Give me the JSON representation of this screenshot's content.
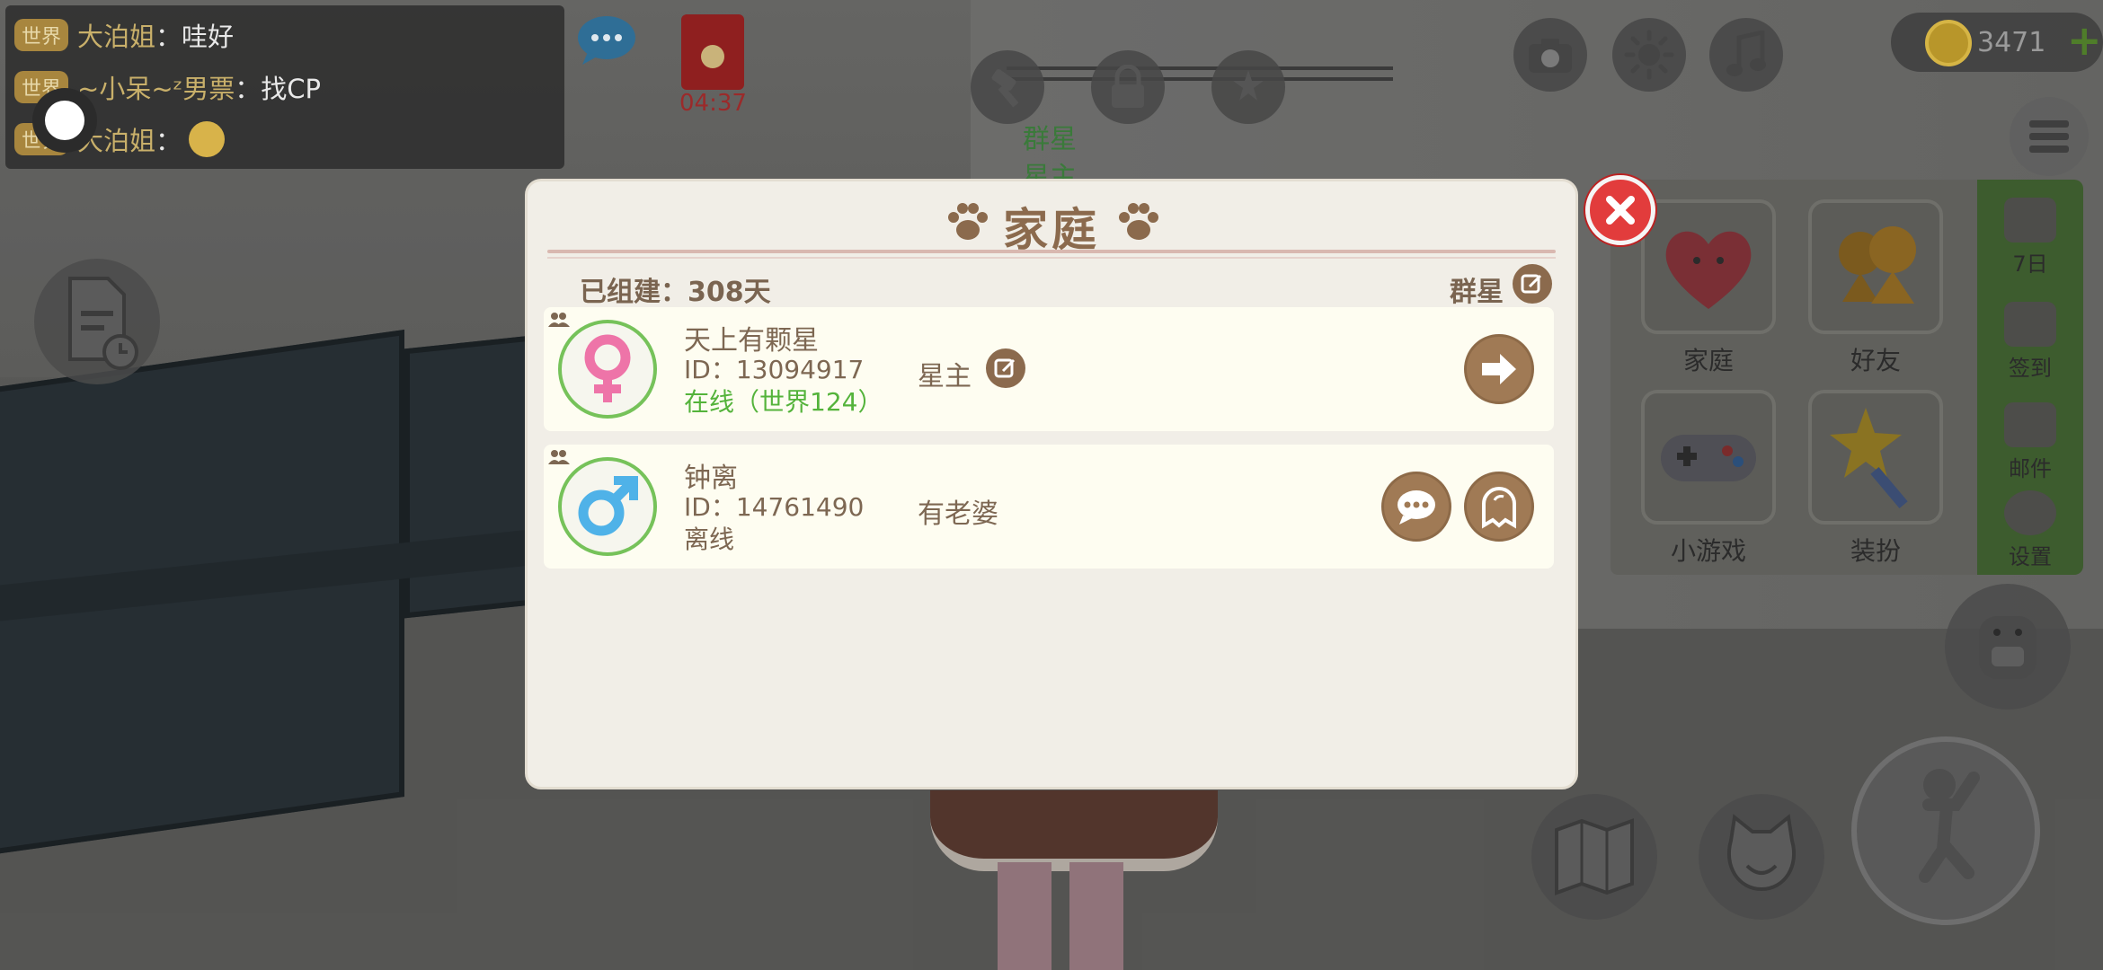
{
  "chat": {
    "lines": [
      {
        "tag": "世界",
        "name": "大泊姐",
        "sep": "：",
        "text": "哇好"
      },
      {
        "tag": "世界",
        "name": "~小呆~ᶻ男票",
        "sep": "：",
        "text": "找CP"
      },
      {
        "tag": "世界",
        "name": "大泊姐",
        "sep": "：",
        "text": ""
      }
    ]
  },
  "red_packet": {
    "timer": "04:37"
  },
  "coins": {
    "amount": "3471"
  },
  "background_labels": {
    "label1": "群星",
    "label2": "星主"
  },
  "menu": {
    "tiles": [
      {
        "label": "家庭",
        "icon": "heart-icon"
      },
      {
        "label": "好友",
        "icon": "friends-icon"
      },
      {
        "label": "小游戏",
        "icon": "gamepad-icon"
      },
      {
        "label": "装扮",
        "icon": "star-wand-icon"
      }
    ],
    "strip": [
      {
        "label": "7日",
        "icon": "seven-day-icon"
      },
      {
        "label": "签到",
        "icon": "calendar-check-icon"
      },
      {
        "label": "邮件",
        "icon": "mail-icon"
      },
      {
        "label": "设置",
        "icon": "gear-icon"
      }
    ]
  },
  "dialog": {
    "title": "家庭",
    "since_label": "已组建：308天",
    "family_name": "群星",
    "members": [
      {
        "name": "天上有颗星",
        "id": "ID：13094917",
        "status": "在线（世界124）",
        "online": true,
        "role": "星主",
        "gender": "female",
        "actions": [
          "exit-icon"
        ]
      },
      {
        "name": "钟离",
        "id": "ID：14761490",
        "status": "离线",
        "online": false,
        "role": "有老婆",
        "gender": "male",
        "actions": [
          "chat-icon",
          "ghost-icon"
        ]
      }
    ]
  },
  "colors": {
    "dialog_bg": "#f1eee7",
    "row_bg": "#fefdf1",
    "brown": "#8b6a4d",
    "online_green": "#54b33b",
    "close_red": "#e23c3c"
  }
}
